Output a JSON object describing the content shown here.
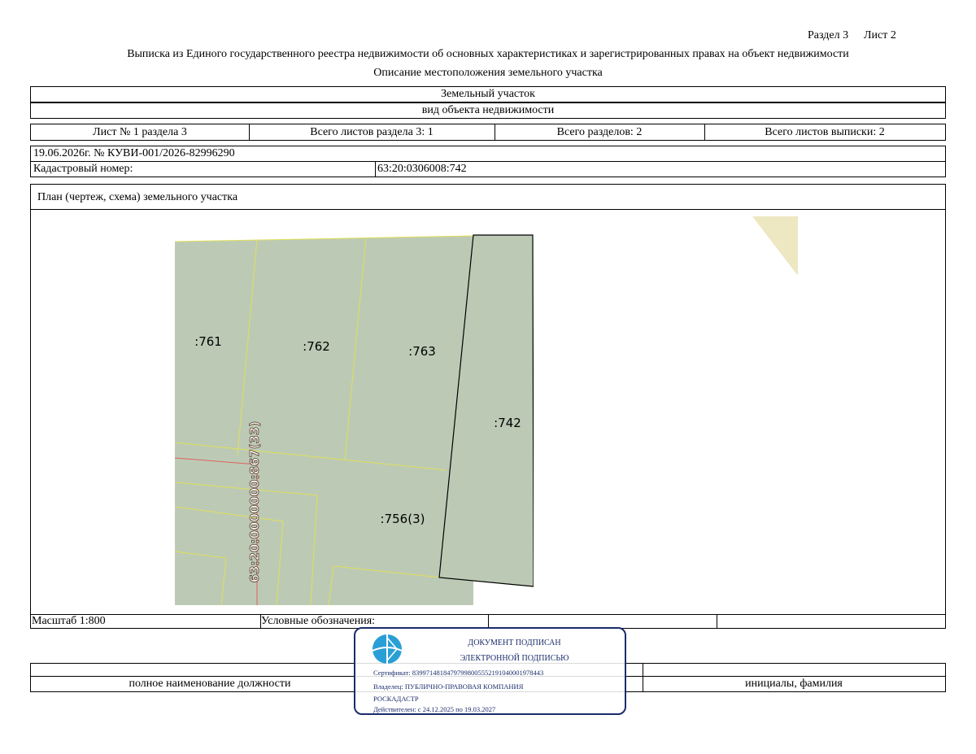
{
  "header": {
    "section": "Раздел 3",
    "sheet": "Лист 2",
    "title": "Выписка из Единого государственного реестра недвижимости об основных характеристиках и зарегистрированных правах на объект недвижимости",
    "subtitle": "Описание местоположения земельного участка"
  },
  "object": {
    "type": "Земельный участок",
    "type_caption": "вид объекта недвижимости"
  },
  "sheets_row": {
    "sheet_of_section": "Лист № 1 раздела 3",
    "total_sheets_section": "Всего листов раздела 3: 1",
    "total_sections": "Всего разделов: 2",
    "total_sheets_extract": "Всего листов выписки: 2"
  },
  "record": {
    "date_number": "19.06.2026г. № КУВИ-001/2026-82996290",
    "cadastral_label": "Кадастровый номер:",
    "cadastral_number": "63:20:0306008:742"
  },
  "plan": {
    "title": "План (чертеж, схема) земельного участка",
    "parcel_labels": [
      ":761",
      ":762",
      ":763",
      ":742",
      ":756(3)"
    ],
    "road_label": "63:20:0000000:867(33)"
  },
  "legend_row": {
    "scale": "Масштаб 1:800",
    "legend_label": "Условные обозначения:"
  },
  "signature_row": {
    "position_caption": "полное наименование должности",
    "name_caption": "инициалы, фамилия"
  },
  "stamp": {
    "line1": "ДОКУМЕНТ ПОДПИСАН",
    "line2": "ЭЛЕКТРОННОЙ ПОДПИСЬЮ",
    "certificate": "Сертификат: 83997148184797998005552191040001978443",
    "owner": "Владелец: ПУБЛИЧНО-ПРАВОВАЯ КОМПАНИЯ",
    "owner2": "РОСКАДАСТР",
    "validity": "Действителен: с 24.12.2025 по 19.03.2027"
  },
  "colors": {
    "parcel_fill": "#bccab5",
    "boundary_yellow": "#e0df58",
    "road_red": "#e06060",
    "stamp_blue": "#1b2c6b",
    "stamp_logo": "#2a9fd6",
    "triangle_fill": "#ede7c2"
  }
}
